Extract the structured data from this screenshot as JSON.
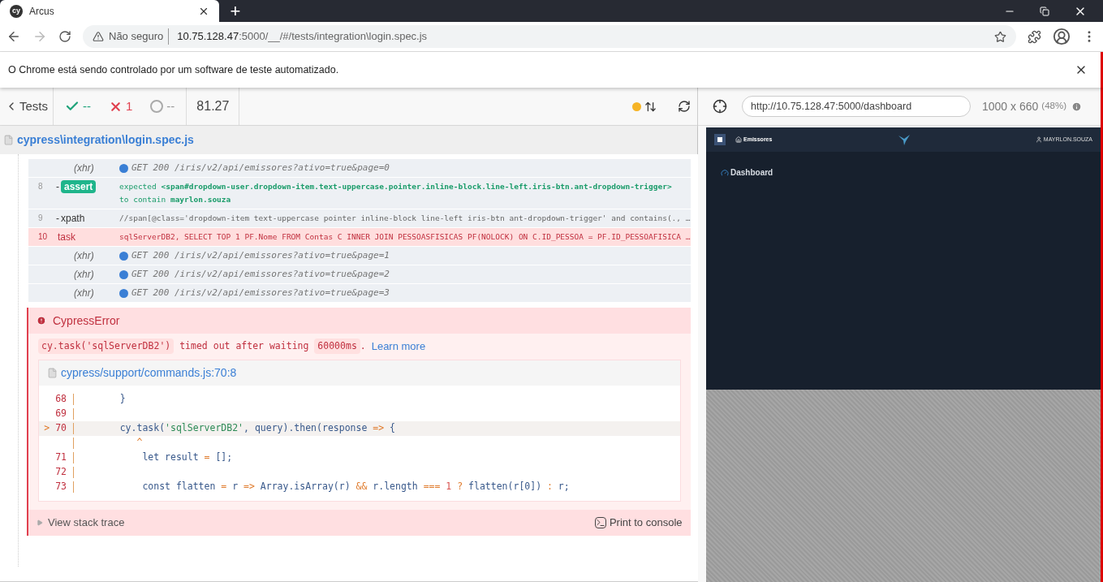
{
  "browser": {
    "tab": {
      "title": "Arcus",
      "logo": "cy"
    },
    "new_tab": "+",
    "address": {
      "security": "Não seguro",
      "host": "10.75.128.47",
      "path": ":5000/__/#/tests/integration\\login.spec.js"
    },
    "infobar": "O Chrome está sendo controlado por um software de teste automatizado."
  },
  "runner": {
    "back": "Tests",
    "passed": "--",
    "failed": "1",
    "pending": "--",
    "duration": "81.27",
    "spec_path": "cypress\\integration\\login.spec.js"
  },
  "commands": [
    {
      "kind": "xhr",
      "name": "(xhr)",
      "lines": [
        "GET 200 /iris/v2/api/emissores?ativo=true&page=0"
      ]
    },
    {
      "kind": "assert",
      "number": "8",
      "prefix": "-",
      "name": "assert",
      "lines": [
        "expected **<span#dropdown-user.dropdown-item.text-uppercase.pointer.inline-block.line-left.iris-btn.ant-dropdown-trigger>**",
        "to contain **mayrlon.souza**"
      ]
    },
    {
      "kind": "command",
      "number": "9",
      "prefix": "-",
      "name": "xpath",
      "lines": [
        "//span[@class='dropdown-item text-uppercase pointer inline-block line-left iris-btn ant-dropdown-trigger' and contains(., …"
      ]
    },
    {
      "kind": "failed",
      "number": "10",
      "name": "task",
      "lines": [
        "sqlServerDB2, SELECT TOP 1 PF.Nome FROM Contas C INNER JOIN PESSOASFISICAS PF(NOLOCK) ON C.ID_PESSOA = PF.ID_PESSOAFISICA …"
      ]
    },
    {
      "kind": "xhr",
      "name": "(xhr)",
      "lines": [
        "GET 200 /iris/v2/api/emissores?ativo=true&page=1"
      ]
    },
    {
      "kind": "xhr",
      "name": "(xhr)",
      "lines": [
        "GET 200 /iris/v2/api/emissores?ativo=true&page=2"
      ]
    },
    {
      "kind": "xhr",
      "name": "(xhr)",
      "lines": [
        "GET 200 /iris/v2/api/emissores?ativo=true&page=3"
      ]
    }
  ],
  "error": {
    "title": "CypressError",
    "message": [
      {
        "kind": "code",
        "text": "cy.task('sqlServerDB2')"
      },
      {
        "kind": "text",
        "text": " timed out after waiting "
      },
      {
        "kind": "code",
        "text": "60000ms"
      },
      {
        "kind": "text",
        "text": ". "
      },
      {
        "kind": "link",
        "text": "Learn more"
      }
    ],
    "file": "cypress/support/commands.js:70:8",
    "code": [
      {
        "number": "68",
        "current": false,
        "tokens": [
          {
            "kind": "plain",
            "text": "    }"
          }
        ]
      },
      {
        "number": "69",
        "current": false
      },
      {
        "number": "70",
        "marker": ">",
        "current": true,
        "tokens": [
          {
            "kind": "plain",
            "text": "    cy.task("
          },
          {
            "kind": "str",
            "text": "'sqlServerDB2'"
          },
          {
            "kind": "plain",
            "text": ", query).then(response "
          },
          {
            "kind": "op",
            "text": "=>"
          },
          {
            "kind": "plain",
            "text": " {"
          }
        ]
      },
      {
        "current": false,
        "tokens": [
          {
            "kind": "op",
            "text": "       ^"
          }
        ]
      },
      {
        "number": "71",
        "current": false,
        "tokens": [
          {
            "kind": "plain",
            "text": "        let result "
          },
          {
            "kind": "op",
            "text": "="
          },
          {
            "kind": "plain",
            "text": " [];"
          }
        ]
      },
      {
        "number": "72",
        "current": false
      },
      {
        "number": "73",
        "current": false,
        "tokens": [
          {
            "kind": "plain",
            "text": "        const flatten "
          },
          {
            "kind": "op",
            "text": "="
          },
          {
            "kind": "plain",
            "text": " r "
          },
          {
            "kind": "op",
            "text": "=>"
          },
          {
            "kind": "plain",
            "text": " Array.isArray(r) "
          },
          {
            "kind": "op",
            "text": "&&"
          },
          {
            "kind": "plain",
            "text": " r.length "
          },
          {
            "kind": "op",
            "text": "==="
          },
          {
            "kind": "num",
            "text": " 1"
          },
          {
            "kind": "op",
            "text": " ?"
          },
          {
            "kind": "plain",
            "text": " flatten(r[0]) "
          },
          {
            "kind": "op",
            "text": ":"
          },
          {
            "kind": "plain",
            "text": " r;"
          }
        ]
      }
    ],
    "stack_trace": "View stack trace",
    "print": "Print to console"
  },
  "aut": {
    "url": "http://10.75.128.47:5000/dashboard",
    "size": "1000 x 660",
    "scale": "(48%)",
    "app": {
      "menu": "Emissores",
      "user": "MAYRLON.SOUZA",
      "page_title": "Dashboard"
    }
  }
}
